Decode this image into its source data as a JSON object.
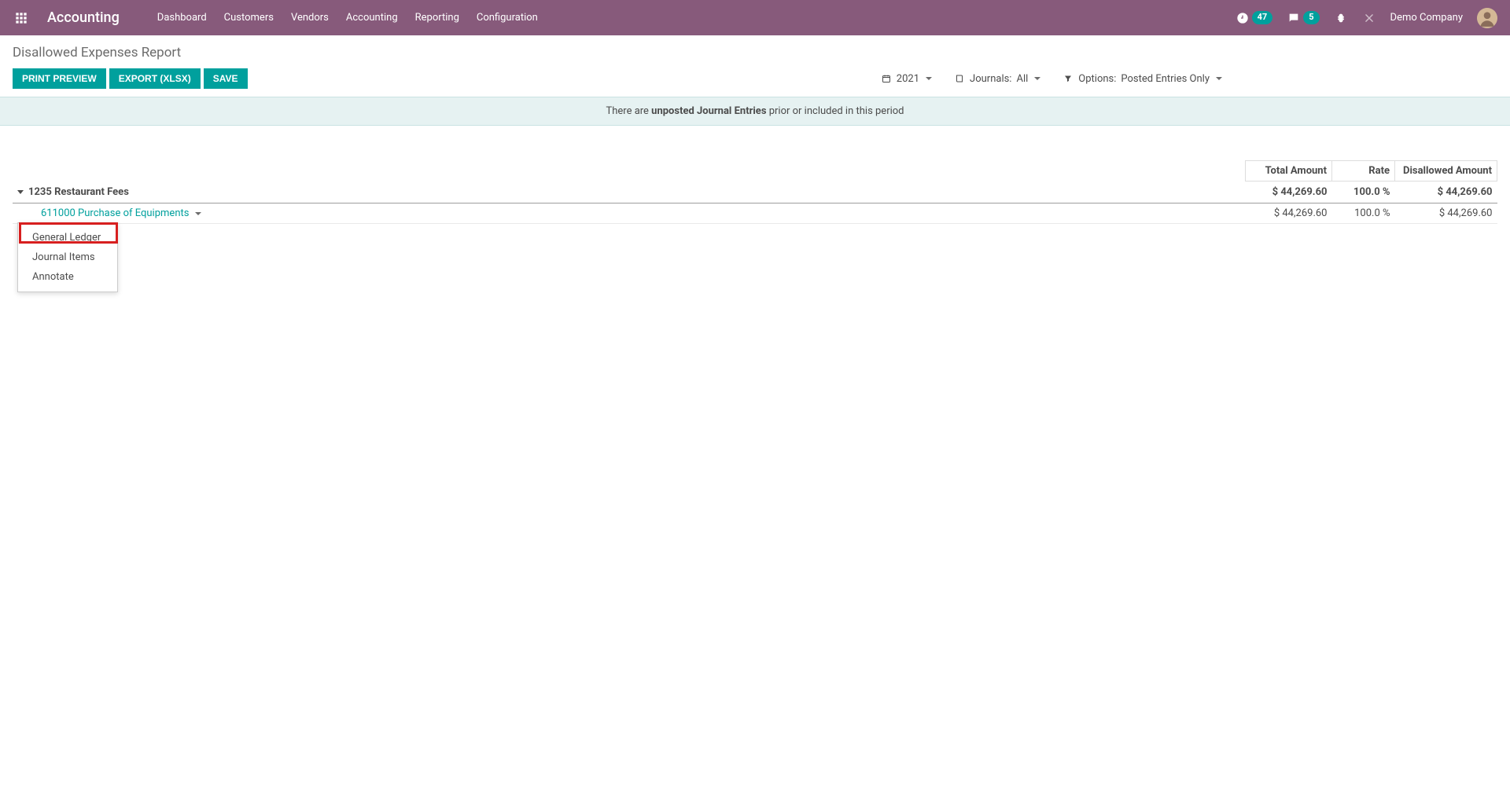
{
  "navbar": {
    "brand": "Accounting",
    "menu": [
      "Dashboard",
      "Customers",
      "Vendors",
      "Accounting",
      "Reporting",
      "Configuration"
    ],
    "activity_count": "47",
    "messages_count": "5",
    "company": "Demo Company"
  },
  "control": {
    "title": "Disallowed Expenses Report",
    "buttons": {
      "print": "PRINT PREVIEW",
      "export": "EXPORT (XLSX)",
      "save": "SAVE"
    },
    "filter_year": "2021",
    "filter_journals_label": "Journals:",
    "filter_journals_value": "All",
    "filter_options_label": "Options:",
    "filter_options_value": "Posted Entries Only"
  },
  "alert": {
    "prefix": "There are ",
    "bold": "unposted Journal Entries",
    "suffix": " prior or included in this period"
  },
  "table": {
    "headers": {
      "total": "Total Amount",
      "rate": "Rate",
      "disallowed": "Disallowed Amount"
    },
    "category": {
      "label": "1235 Restaurant Fees",
      "total": "$ 44,269.60",
      "rate": "100.0 %",
      "disallowed": "$ 44,269.60"
    },
    "line": {
      "label": "611000 Purchase of Equipments",
      "total": "$ 44,269.60",
      "rate": "100.0 %",
      "disallowed": "$ 44,269.60"
    }
  },
  "menu": {
    "general_ledger": "General Ledger",
    "journal_items": "Journal Items",
    "annotate": "Annotate"
  }
}
